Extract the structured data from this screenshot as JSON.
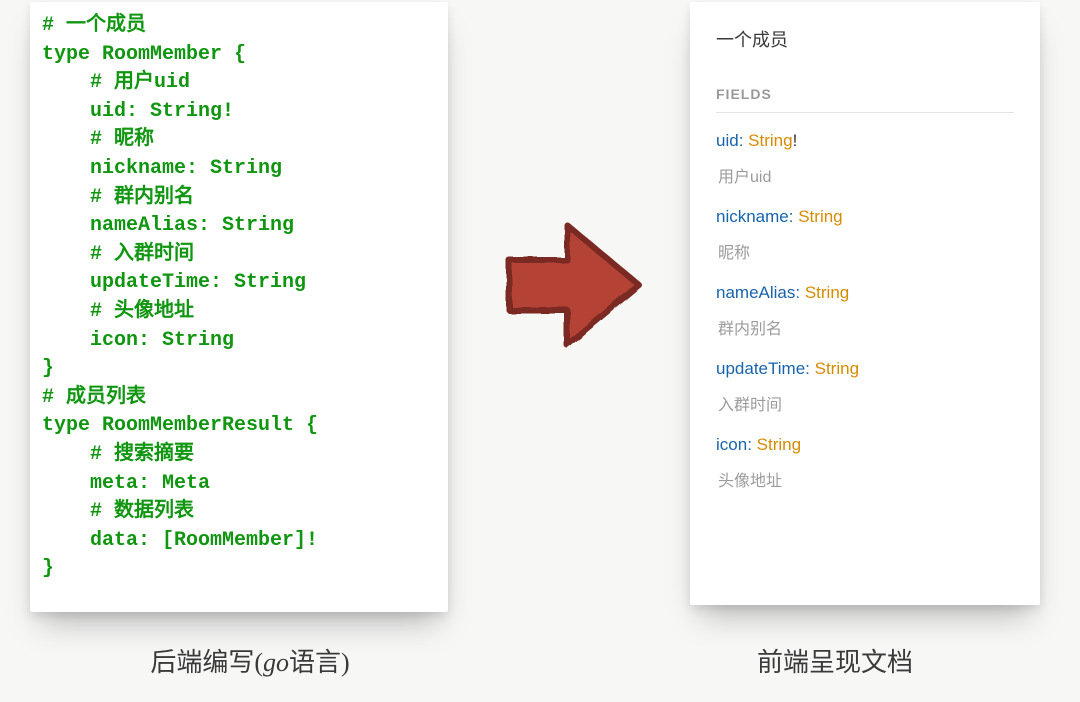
{
  "left_panel": {
    "lines": [
      "# 一个成员",
      "type RoomMember {",
      "    # 用户uid",
      "    uid: String!",
      "    # 昵称",
      "    nickname: String",
      "    # 群内别名",
      "    nameAlias: String",
      "    # 入群时间",
      "    updateTime: String",
      "    # 头像地址",
      "    icon: String",
      "}",
      "# 成员列表",
      "type RoomMemberResult {",
      "    # 搜索摘要",
      "    meta: Meta",
      "    # 数据列表",
      "    data: [RoomMember]!",
      "}"
    ]
  },
  "right_panel": {
    "title": "一个成员",
    "fields_label": "FIELDS",
    "fields": [
      {
        "name": "uid",
        "type": "String",
        "required": true,
        "desc": "用户uid"
      },
      {
        "name": "nickname",
        "type": "String",
        "required": false,
        "desc": "昵称"
      },
      {
        "name": "nameAlias",
        "type": "String",
        "required": false,
        "desc": "群内别名"
      },
      {
        "name": "updateTime",
        "type": "String",
        "required": false,
        "desc": "入群时间"
      },
      {
        "name": "icon",
        "type": "String",
        "required": false,
        "desc": "头像地址"
      }
    ]
  },
  "captions": {
    "left_pre": "后端编写(",
    "left_go": "go",
    "left_post": "语言)",
    "right": "前端呈现文档"
  }
}
